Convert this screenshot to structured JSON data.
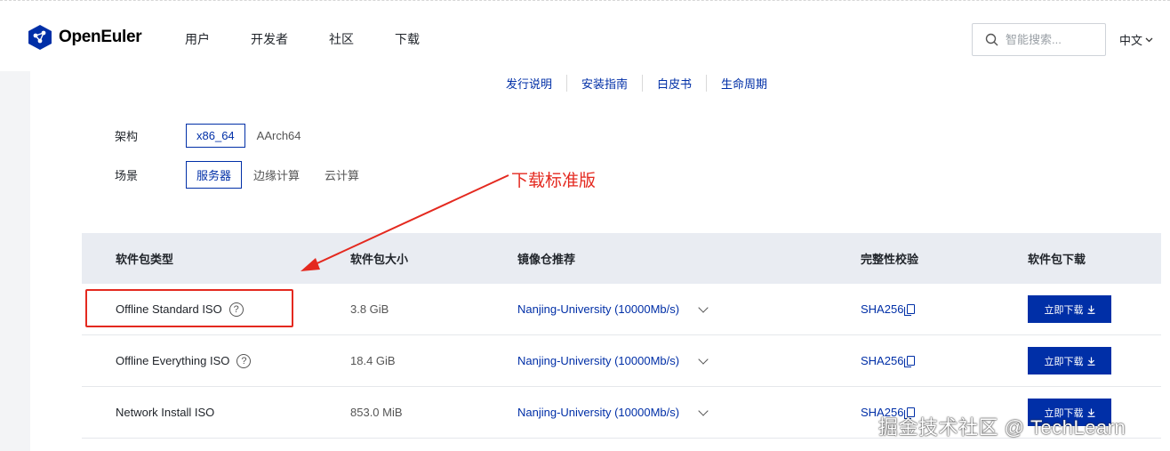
{
  "header": {
    "logo_text": "OpenEuler",
    "nav": [
      "用户",
      "开发者",
      "社区",
      "下载"
    ],
    "search_placeholder": "智能搜索...",
    "language": "中文"
  },
  "subnav": [
    "发行说明",
    "安装指南",
    "白皮书",
    "生命周期"
  ],
  "filters": {
    "arch": {
      "label": "架构",
      "options": [
        "x86_64",
        "AArch64"
      ],
      "selected": "x86_64"
    },
    "scene": {
      "label": "场景",
      "options": [
        "服务器",
        "边缘计算",
        "云计算"
      ],
      "selected": "服务器"
    }
  },
  "annotation": {
    "text": "下载标准版",
    "color": "#e4291f"
  },
  "table": {
    "headers": [
      "软件包类型",
      "软件包大小",
      "镜像仓推荐",
      "完整性校验",
      "软件包下载"
    ],
    "rows": [
      {
        "type": "Offline Standard ISO",
        "help": true,
        "size": "3.8 GiB",
        "mirror": "Nanjing-University (10000Mb/s)",
        "checksum": "SHA256",
        "button": "立即下载"
      },
      {
        "type": "Offline Everything ISO",
        "help": true,
        "size": "18.4 GiB",
        "mirror": "Nanjing-University (10000Mb/s)",
        "checksum": "SHA256",
        "button": "立即下载"
      },
      {
        "type": "Network Install ISO",
        "help": false,
        "size": "853.0 MiB",
        "mirror": "Nanjing-University (10000Mb/s)",
        "checksum": "SHA256",
        "button": "立即下载"
      }
    ]
  },
  "watermark": "掘金技术社区 @ TechLearn",
  "colors": {
    "brand": "#002fa7",
    "annotation": "#e4291f",
    "header_bg": "#e9ecf2"
  }
}
